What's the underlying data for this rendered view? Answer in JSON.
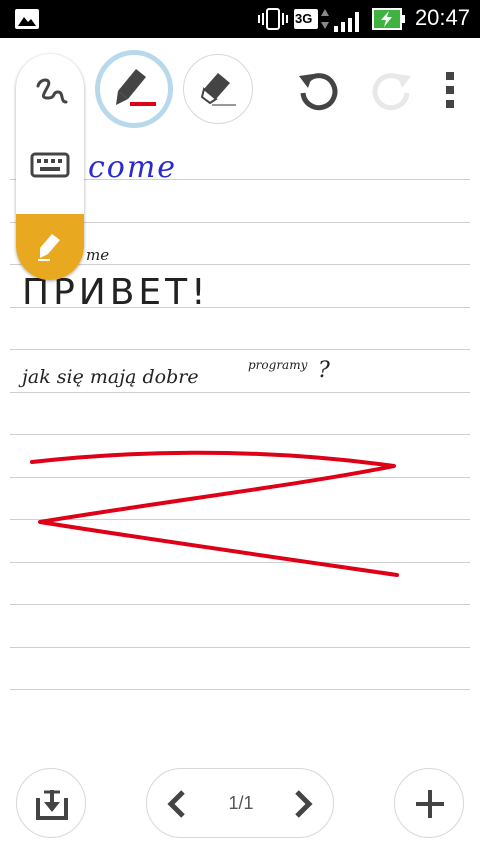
{
  "status_bar": {
    "network": "3G",
    "time": "20:47"
  },
  "toolbar": {
    "tools": [
      {
        "icon": "handwriting-icon",
        "state": "inactive"
      },
      {
        "icon": "keyboard-icon",
        "state": "inactive"
      },
      {
        "icon": "highlighter-icon",
        "state": "active"
      },
      {
        "icon": "pen-icon",
        "state": "selected"
      },
      {
        "icon": "eraser-icon",
        "state": "inactive"
      }
    ],
    "undo_icon": "undo-icon",
    "redo_icon": "redo-icon",
    "menu_icon": "more-vertical-icon"
  },
  "note": {
    "lines": [
      {
        "text": "Welcome",
        "visible_text": "come",
        "color": "#2a2ad0"
      },
      {
        "text": "me",
        "color": "#222222"
      },
      {
        "text": "ПРИВЕТ!",
        "color": "#222222"
      },
      {
        "text": "jak się mają dobre",
        "color": "#222222"
      },
      {
        "text": "programy",
        "color": "#222222"
      },
      {
        "text": "?",
        "color": "#222222"
      }
    ],
    "ink_color": "#dd0016"
  },
  "bottom_bar": {
    "page_indicator": "1/1"
  },
  "colors": {
    "accent": "#e8a820",
    "pen_selected_ring": "#b8d8ec",
    "rule_line": "#cfcfcf"
  }
}
